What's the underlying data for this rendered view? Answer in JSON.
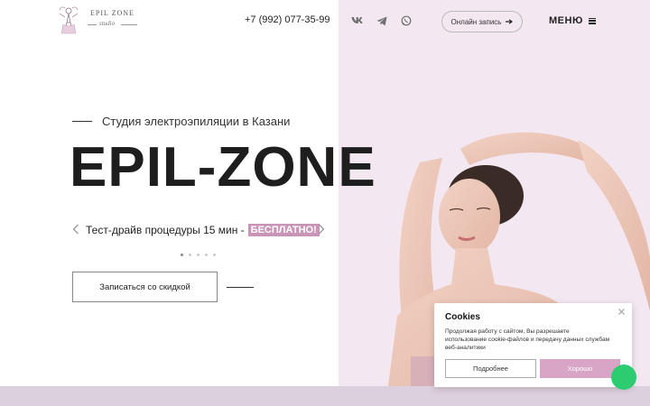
{
  "header": {
    "logo": {
      "line1": "EPIL ZONE",
      "line2": "studio"
    },
    "phone": "+7 (992) 077-35-99",
    "social": [
      "vk-icon",
      "telegram-icon",
      "whatsapp-icon"
    ],
    "online_button": "Онлайн запись",
    "menu_label": "МЕНЮ"
  },
  "hero": {
    "subtitle": "Студия электроэпиляции в Казани",
    "title": "EPIL-ZONE",
    "promo_text": "Тест-драйв процедуры 15 мин -",
    "promo_badge": "БЕСПЛАТНО!",
    "slides_total": 5,
    "slide_active": 1,
    "cta": "Записаться со скидкой"
  },
  "cookie": {
    "title": "Cookies",
    "text": "Продолжая работу с сайтом, Вы разрешаете использование cookie-файлов и передачу данных службам веб-аналитики",
    "more_label": "Подробнее",
    "ok_label": "Хорошо"
  },
  "colors": {
    "accent": "#c995b7",
    "panel_bg": "#f3e7f1",
    "button_pink": "#d9a5c6",
    "whatsapp_green": "#2ecc71"
  }
}
